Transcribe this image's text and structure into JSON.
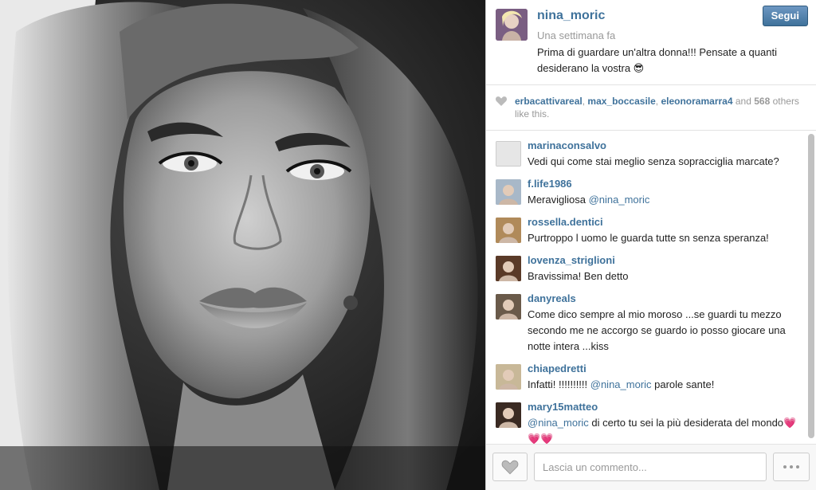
{
  "post": {
    "owner": "nina_moric",
    "time": "Una settimana fa",
    "follow_label": "Segui",
    "caption": "Prima di guardare un'altra donna!!! Pensate a quanti desiderano la vostra 😎"
  },
  "likes": {
    "users": [
      "erbacattivareal",
      "max_boccasile",
      "eleonoramarra4"
    ],
    "sep1": ", ",
    "sep2": ", ",
    "and_text": " and ",
    "count": "568",
    "others_text": " others like this."
  },
  "comments": [
    {
      "user": "marinaconsalvo",
      "parts": [
        {
          "t": "Vedi qui come stai meglio senza sopracciglia marcate?"
        }
      ],
      "avatar": "placeholder-avatar",
      "avatar_color": "#e8e8e8"
    },
    {
      "user": "f.life1986",
      "parts": [
        {
          "t": "Meravigliosa "
        },
        {
          "m": "@nina_moric"
        }
      ],
      "avatar": "baby-avatar",
      "avatar_color": "#a8b8c8"
    },
    {
      "user": "rossella.dentici",
      "parts": [
        {
          "t": "Purtroppo l uomo le guarda tutte sn senza speranza!"
        }
      ],
      "avatar": "blonde-avatar",
      "avatar_color": "#b08a5a"
    },
    {
      "user": "lovenza_striglioni",
      "parts": [
        {
          "t": "Bravissima! Ben detto"
        }
      ],
      "avatar": "dark-hair-avatar",
      "avatar_color": "#5a3a28"
    },
    {
      "user": "danyreals",
      "parts": [
        {
          "t": "Come dico sempre al mio moroso ...se guardi tu mezzo secondo me ne accorgo se guardo io posso giocare una notte intera ...kiss"
        }
      ],
      "avatar": "selfie-avatar",
      "avatar_color": "#6a5a4a"
    },
    {
      "user": "chiapedretti",
      "parts": [
        {
          "t": "Infatti! !!!!!!!!!! "
        },
        {
          "m": "@nina_moric"
        },
        {
          "t": " parole sante!"
        }
      ],
      "avatar": "blonde-avatar-2",
      "avatar_color": "#c8b898"
    },
    {
      "user": "mary15matteo",
      "parts": [
        {
          "m": "@nina_moric"
        },
        {
          "t": " di certo tu sei la più desiderata del mondo💗💗💗"
        }
      ],
      "avatar": "brunette-avatar",
      "avatar_color": "#3a2a22"
    }
  ],
  "footer": {
    "placeholder": "Lascia un commento...",
    "like_icon": "heart-outline-icon",
    "more_icon": "more-dots-icon"
  },
  "colors": {
    "link_blue": "#3f729b",
    "follow_btn": "#3f729b"
  }
}
